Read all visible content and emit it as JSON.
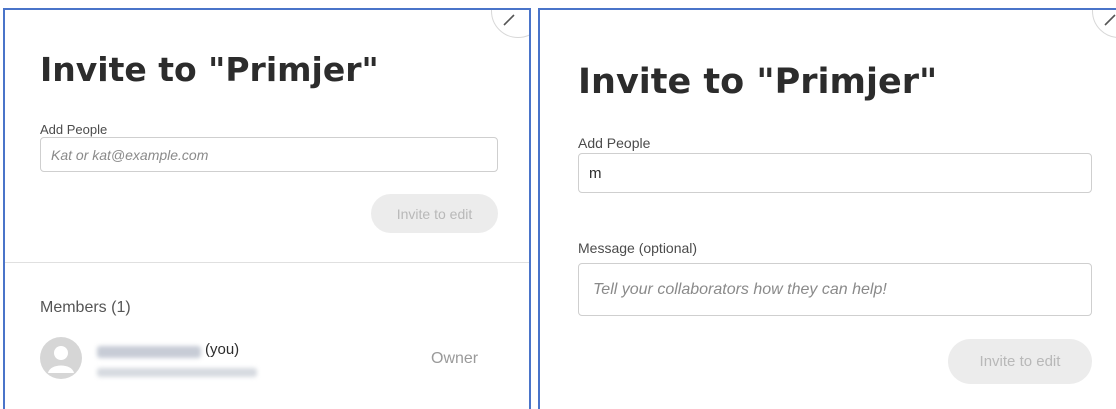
{
  "left_dialog": {
    "title": "Invite to \"Primjer\"",
    "add_people_label": "Add People",
    "add_people_placeholder": "Kat or kat@example.com",
    "invite_button": "Invite to edit",
    "members_heading": "Members (1)",
    "member": {
      "you_suffix": "(you)",
      "role": "Owner"
    }
  },
  "right_dialog": {
    "title": "Invite to \"Primjer\"",
    "add_people_label": "Add People",
    "add_people_value": "m",
    "message_label": "Message (optional)",
    "message_placeholder": "Tell your collaborators how they can help!",
    "invite_button": "Invite to edit"
  },
  "colors": {
    "border_accent": "#4a74c9",
    "disabled_button_bg": "#ececec",
    "disabled_button_text": "#b8b8b8"
  },
  "icons": [
    "close-icon",
    "avatar-icon"
  ]
}
